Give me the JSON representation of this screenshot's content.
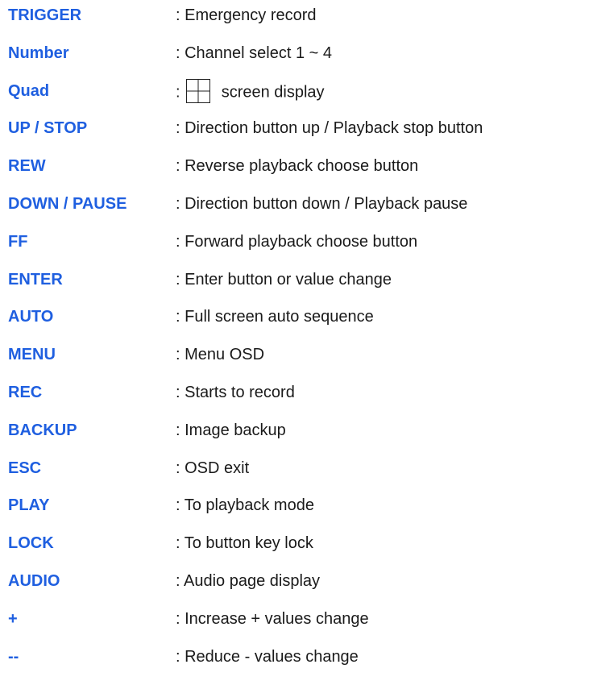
{
  "rows": [
    {
      "key": "TRIGGER",
      "desc": ": Emergency record"
    },
    {
      "key": "Number",
      "desc": ": Channel select 1 ~ 4"
    },
    {
      "key": "Quad",
      "desc_prefix": ":",
      "desc_suffix": "screen display"
    },
    {
      "key": "UP / STOP",
      "desc": ": Direction button up / Playback stop button"
    },
    {
      "key": "REW",
      "desc": ": Reverse playback choose button"
    },
    {
      "key": "DOWN / PAUSE",
      "desc": ": Direction button down / Playback pause"
    },
    {
      "key": "FF",
      "desc": ": Forward playback choose button"
    },
    {
      "key": "ENTER",
      "desc": ": Enter button or value change"
    },
    {
      "key": "AUTO",
      "desc": ": Full screen auto sequence"
    },
    {
      "key": "MENU",
      "desc": ": Menu OSD"
    },
    {
      "key": "REC",
      "desc": ": Starts to record"
    },
    {
      "key": "BACKUP",
      "desc": ": Image backup"
    },
    {
      "key": "ESC",
      "desc": ": OSD exit"
    },
    {
      "key": "PLAY",
      "desc": ": To playback mode"
    },
    {
      "key": "LOCK",
      "desc": ": To button key lock"
    },
    {
      "key": "AUDIO",
      "desc": ": Audio page display"
    },
    {
      "key": "+",
      "desc": ": Increase + values change"
    },
    {
      "key": "--",
      "desc": ": Reduce - values change"
    }
  ],
  "colors": {
    "key": "#1f5fe0",
    "desc": "#1a1a1a"
  },
  "icons": {
    "quad": "quad-grid-icon"
  }
}
